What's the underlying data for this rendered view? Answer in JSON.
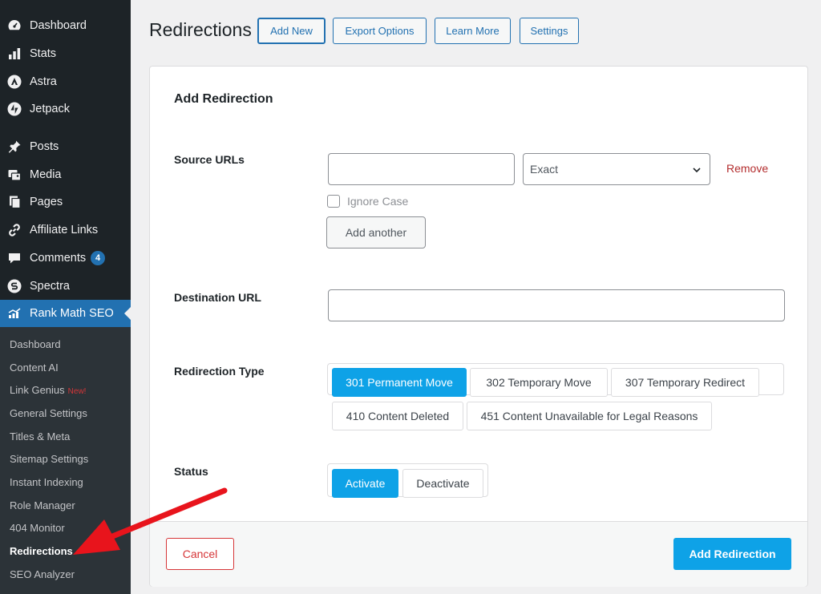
{
  "sidebar": {
    "menu": [
      {
        "label": "Dashboard",
        "icon": "dashboard-icon"
      },
      {
        "label": "Stats",
        "icon": "stats-icon"
      },
      {
        "label": "Astra",
        "icon": "astra-icon"
      },
      {
        "label": "Jetpack",
        "icon": "jetpack-icon"
      },
      {
        "label": "Posts",
        "icon": "pin-icon"
      },
      {
        "label": "Media",
        "icon": "media-icon"
      },
      {
        "label": "Pages",
        "icon": "pages-icon"
      },
      {
        "label": "Affiliate Links",
        "icon": "link-icon"
      },
      {
        "label": "Comments",
        "icon": "comment-icon",
        "badge": "4"
      },
      {
        "label": "Spectra",
        "icon": "spectra-icon"
      },
      {
        "label": "Rank Math SEO",
        "icon": "rank-math-icon"
      }
    ],
    "submenu": [
      {
        "label": "Dashboard"
      },
      {
        "label": "Content AI"
      },
      {
        "label": "Link Genius",
        "tag": "New!"
      },
      {
        "label": "General Settings"
      },
      {
        "label": "Titles & Meta"
      },
      {
        "label": "Sitemap Settings"
      },
      {
        "label": "Instant Indexing"
      },
      {
        "label": "Role Manager"
      },
      {
        "label": "404 Monitor"
      },
      {
        "label": "Redirections"
      },
      {
        "label": "SEO Analyzer"
      }
    ]
  },
  "header": {
    "title": "Redirections",
    "buttons": [
      "Add New",
      "Export Options",
      "Learn More",
      "Settings"
    ]
  },
  "form": {
    "title": "Add Redirection",
    "source_label": "Source URLs",
    "source_value": "",
    "match_type": "Exact",
    "remove_label": "Remove",
    "ignore_case_label": "Ignore Case",
    "add_another_label": "Add another",
    "destination_label": "Destination URL",
    "destination_value": "",
    "type_label": "Redirection Type",
    "types": [
      "301 Permanent Move",
      "302 Temporary Move",
      "307 Temporary Redirect",
      "410 Content Deleted",
      "451 Content Unavailable for Legal Reasons"
    ],
    "selected_type": "301 Permanent Move",
    "status_label": "Status",
    "statuses": [
      "Activate",
      "Deactivate"
    ],
    "selected_status": "Activate",
    "cancel_label": "Cancel",
    "submit_label": "Add Redirection"
  },
  "colors": {
    "sidebar_bg": "#1d2327",
    "active_bg": "#2271b1",
    "accent": "#0ea2e7",
    "danger": "#d63638",
    "annotation_arrow": "#e8141c"
  }
}
